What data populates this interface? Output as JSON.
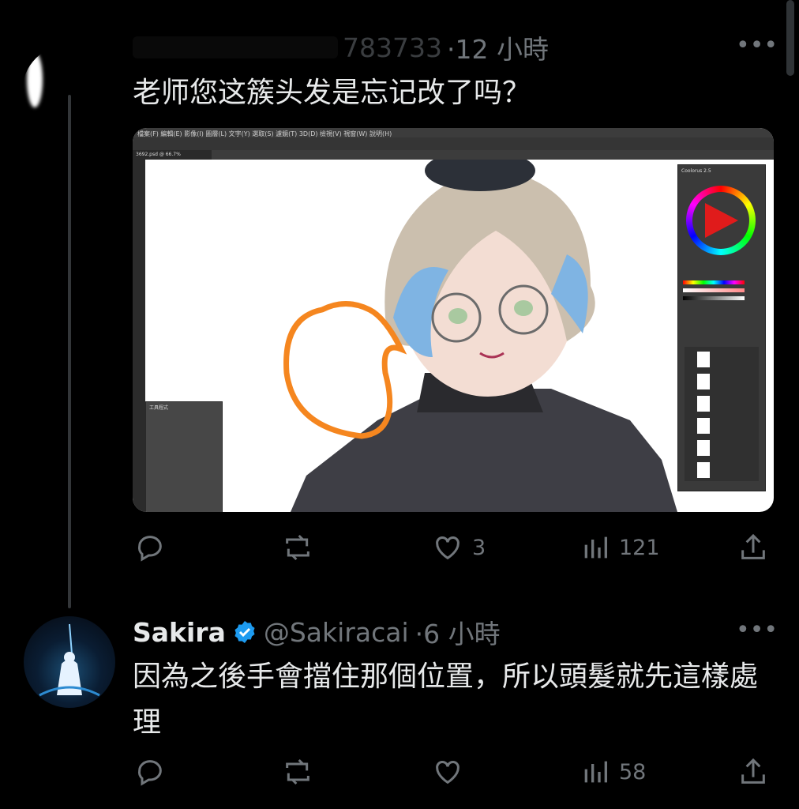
{
  "tweet1": {
    "handle_partial": "783733",
    "time": "·12 小時",
    "text": "老师您这簇头发是忘记改了吗？",
    "more_icon": "more-horizontal-icon",
    "replies": "",
    "retweets": "",
    "likes": "3",
    "views": "121"
  },
  "reply": {
    "name": "Sakira",
    "verified_badge": "verified-badge-icon",
    "handle": "@Sakiracai",
    "time": "·6 小時",
    "text": "因為之後手會擋住那個位置，所以頭髮就先這樣處理",
    "likes": "",
    "views": "58"
  },
  "colors": {
    "background": "#000000",
    "text": "#e7e9ea",
    "muted": "#71767b",
    "verified": "#1d9bf0",
    "annotation": "#f5861f"
  }
}
